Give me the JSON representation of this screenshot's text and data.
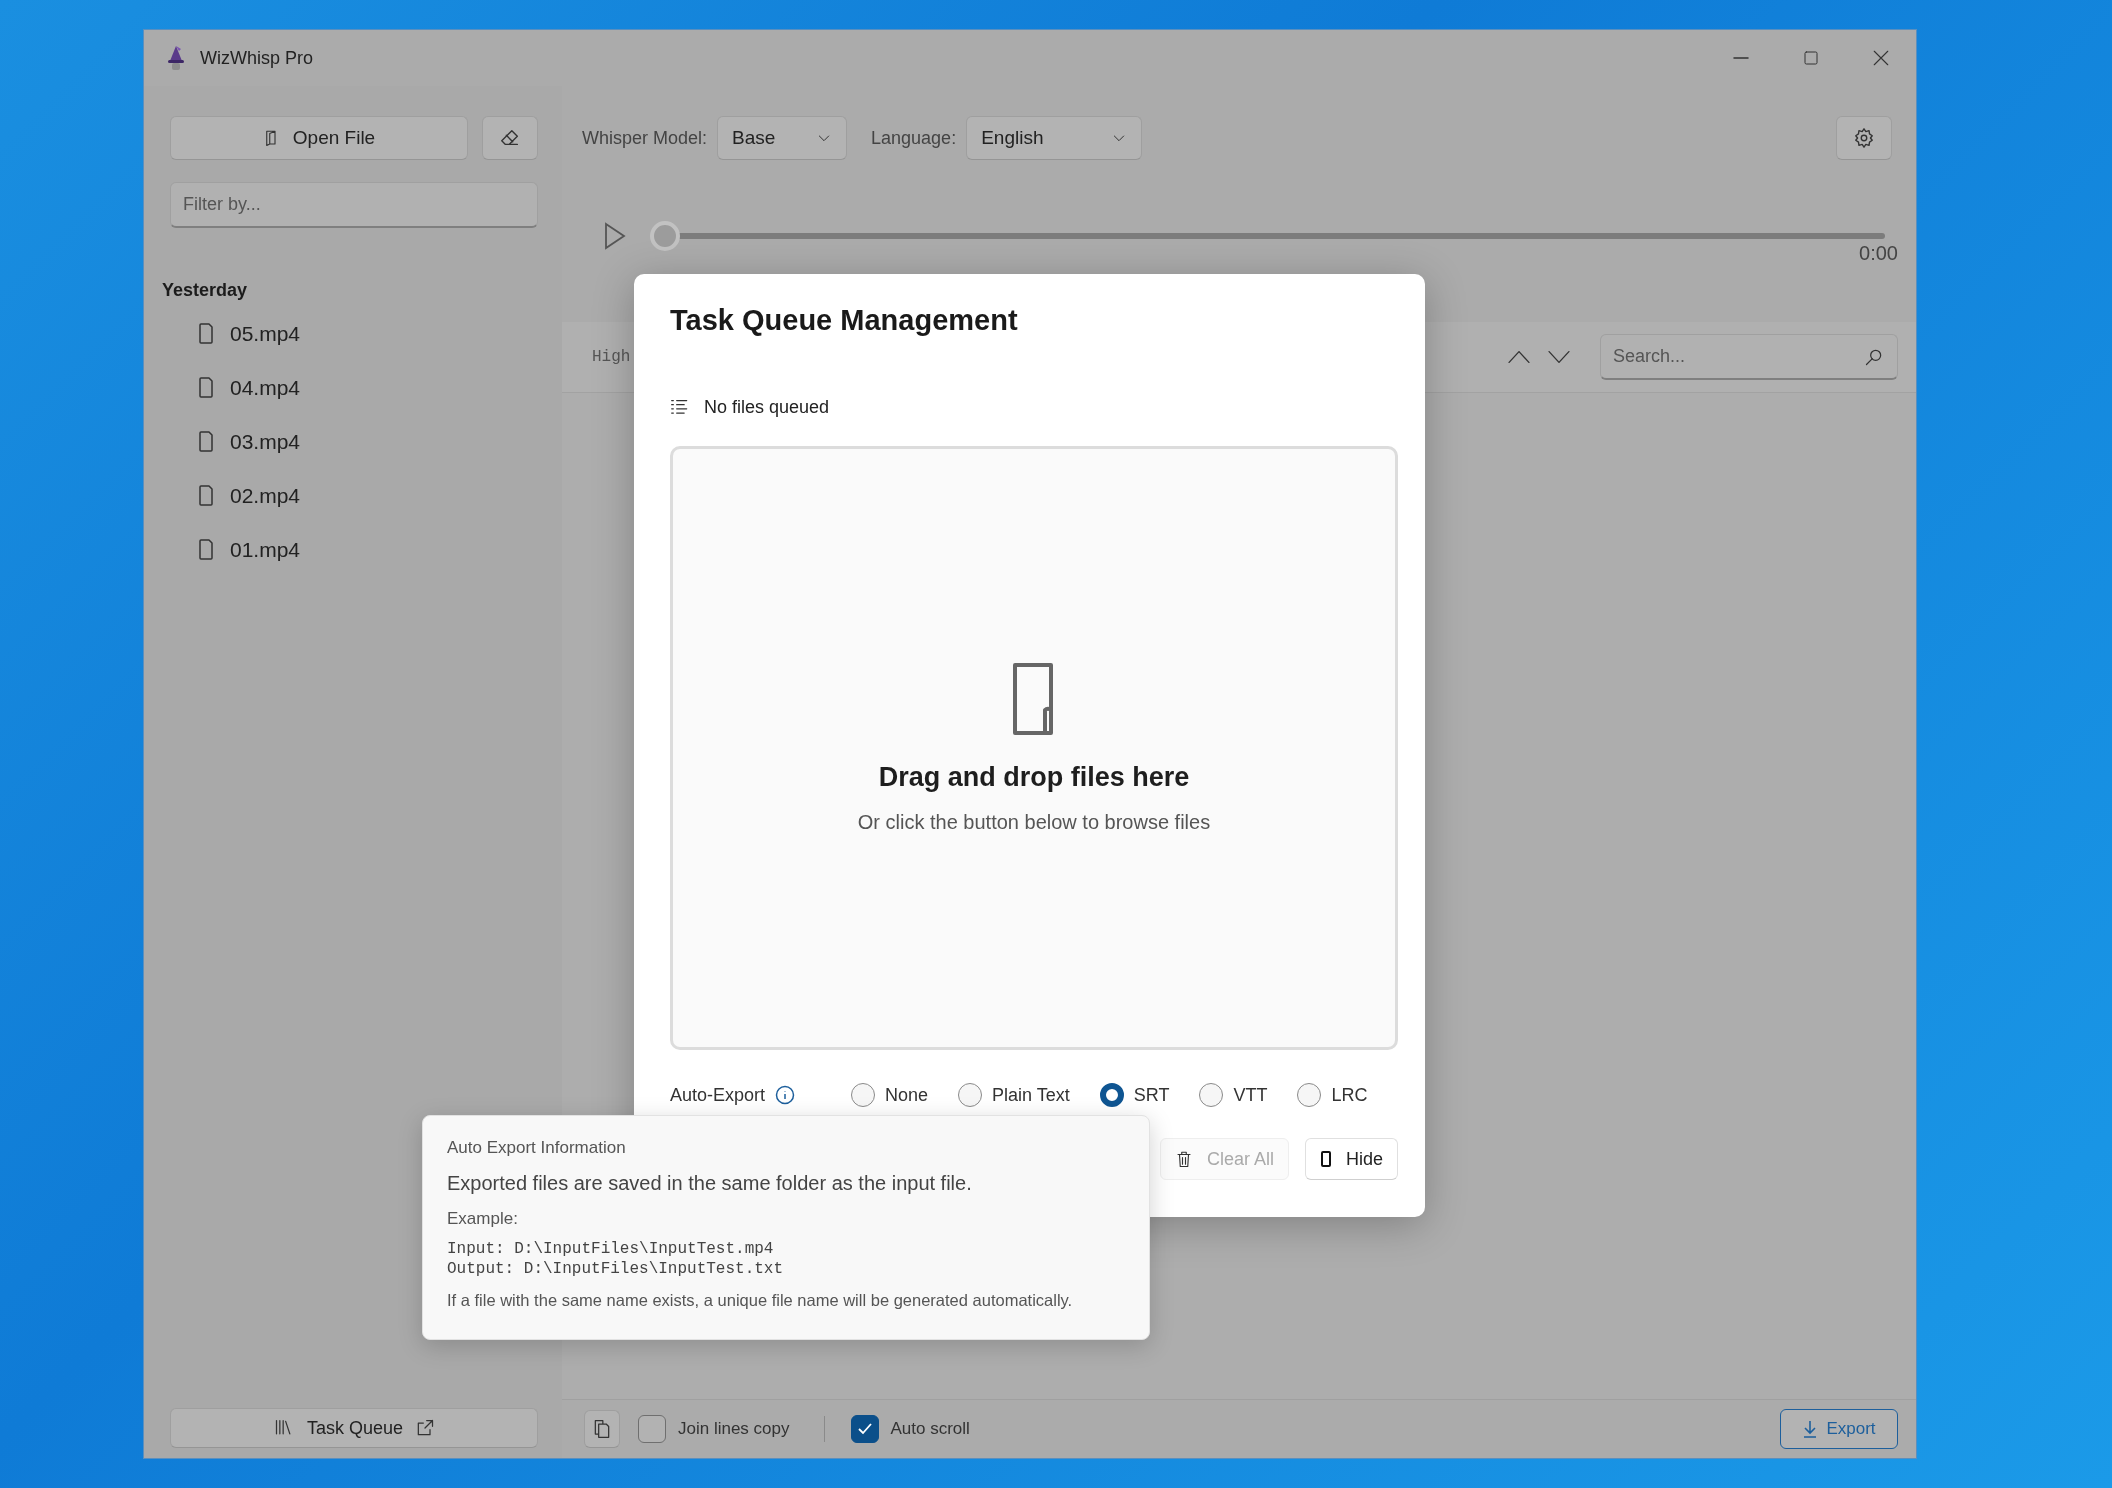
{
  "window": {
    "title": "WizWhisp Pro"
  },
  "toolbar": {
    "open_file": "Open File",
    "whisper_model_label": "Whisper Model:",
    "whisper_model": "Base",
    "language_label": "Language:",
    "language": "English"
  },
  "sidebar": {
    "filter": {
      "placeholder": "Filter by..."
    },
    "groups": [
      {
        "label": "Yesterday",
        "items": [
          {
            "name": "05.mp4"
          },
          {
            "name": "04.mp4"
          },
          {
            "name": "03.mp4"
          },
          {
            "name": "02.mp4"
          },
          {
            "name": "01.mp4"
          }
        ]
      }
    ],
    "task_queue": "Task Queue"
  },
  "player": {
    "level": 0,
    "duration": "0:00"
  },
  "transcript_bar": {
    "column_1": "High",
    "search": {
      "placeholder": "Search..."
    }
  },
  "footer": {
    "checkboxes": [
      {
        "label": "Join lines copy",
        "checked": false
      },
      {
        "label": "Auto scroll",
        "checked": true
      }
    ],
    "export": "Export"
  },
  "dialog": {
    "title": "Task Queue Management",
    "status": "No files queued",
    "drop_title": "Drag and drop files here",
    "drop_hint": "Or click the button below to browse files",
    "auto_export_label": "Auto-Export",
    "formats": [
      {
        "label": "None",
        "selected": false
      },
      {
        "label": "Plain Text",
        "selected": false
      },
      {
        "label": "SRT",
        "selected": true
      },
      {
        "label": "VTT",
        "selected": false
      },
      {
        "label": "LRC",
        "selected": false
      }
    ],
    "buttons": [
      {
        "kind": "clear",
        "label": "Clear All",
        "disabled": true
      },
      {
        "kind": "hide",
        "label": "Hide",
        "disabled": false
      }
    ]
  },
  "tooltip": {
    "title": "Auto Export Information",
    "text": "Exported files are saved in the same folder as the input file.",
    "example_label": "Example:",
    "example_lines": [
      "Input: D:\\InputFiles\\InputTest.mp4",
      "Output: D:\\InputFiles\\InputTest.txt"
    ],
    "note": "If a file with the same name exists, a unique file name will be generated automatically."
  }
}
